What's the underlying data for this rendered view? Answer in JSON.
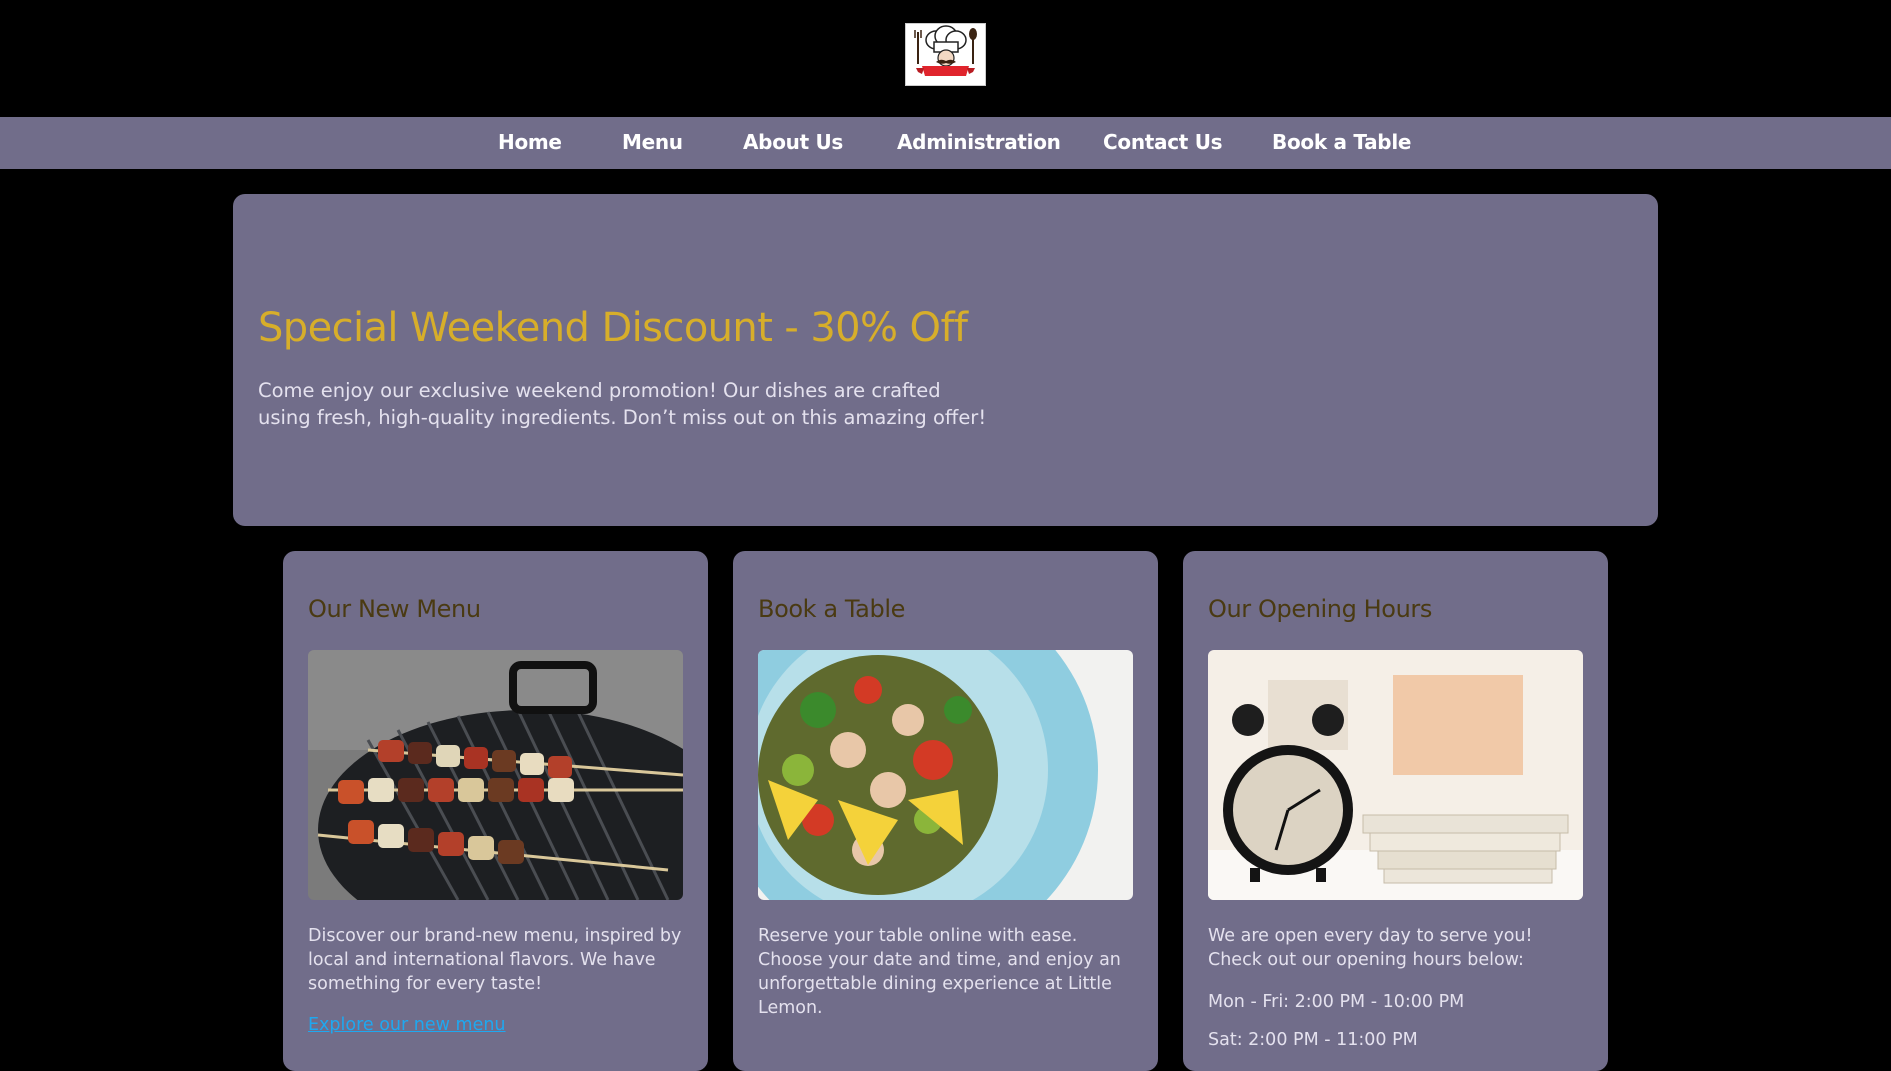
{
  "brand": {
    "logo_icon": "chef-mustache-logo"
  },
  "nav": {
    "items": [
      {
        "label": "Home"
      },
      {
        "label": "Menu"
      },
      {
        "label": "About Us"
      },
      {
        "label": "Administration"
      },
      {
        "label": "Contact Us"
      },
      {
        "label": "Book a Table"
      }
    ]
  },
  "hero": {
    "title": "Special Weekend Discount - 30% Off",
    "text": "Come enjoy our exclusive weekend promotion! Our dishes are crafted using fresh, high-quality ingredients. Don’t miss out on this amazing offer!"
  },
  "cards": [
    {
      "title": "Our New Menu",
      "image": "grilled-skewers-image",
      "text": "Discover our brand-new menu, inspired by local and international flavors. We have something for every taste!",
      "link": "Explore our new menu"
    },
    {
      "title": "Book a Table",
      "image": "salad-plate-image",
      "text": "Reserve your table online with ease. Choose your date and time, and enjoy an unforgettable dining experience at Little Lemon."
    },
    {
      "title": "Our Opening Hours",
      "image": "alarm-clock-image",
      "text": "We are open every day to serve you! Check out our opening hours below:",
      "hours": [
        "Mon - Fri: 2:00 PM - 10:00 PM",
        "Sat: 2:00 PM - 11:00 PM"
      ]
    }
  ],
  "colors": {
    "page_bg": "#000000",
    "panel_bg": "#716d8a",
    "hero_title": "#d7ae2a",
    "card_title": "#4a3a12",
    "body_text": "#e4e1ee",
    "link": "#1ea8f0"
  }
}
